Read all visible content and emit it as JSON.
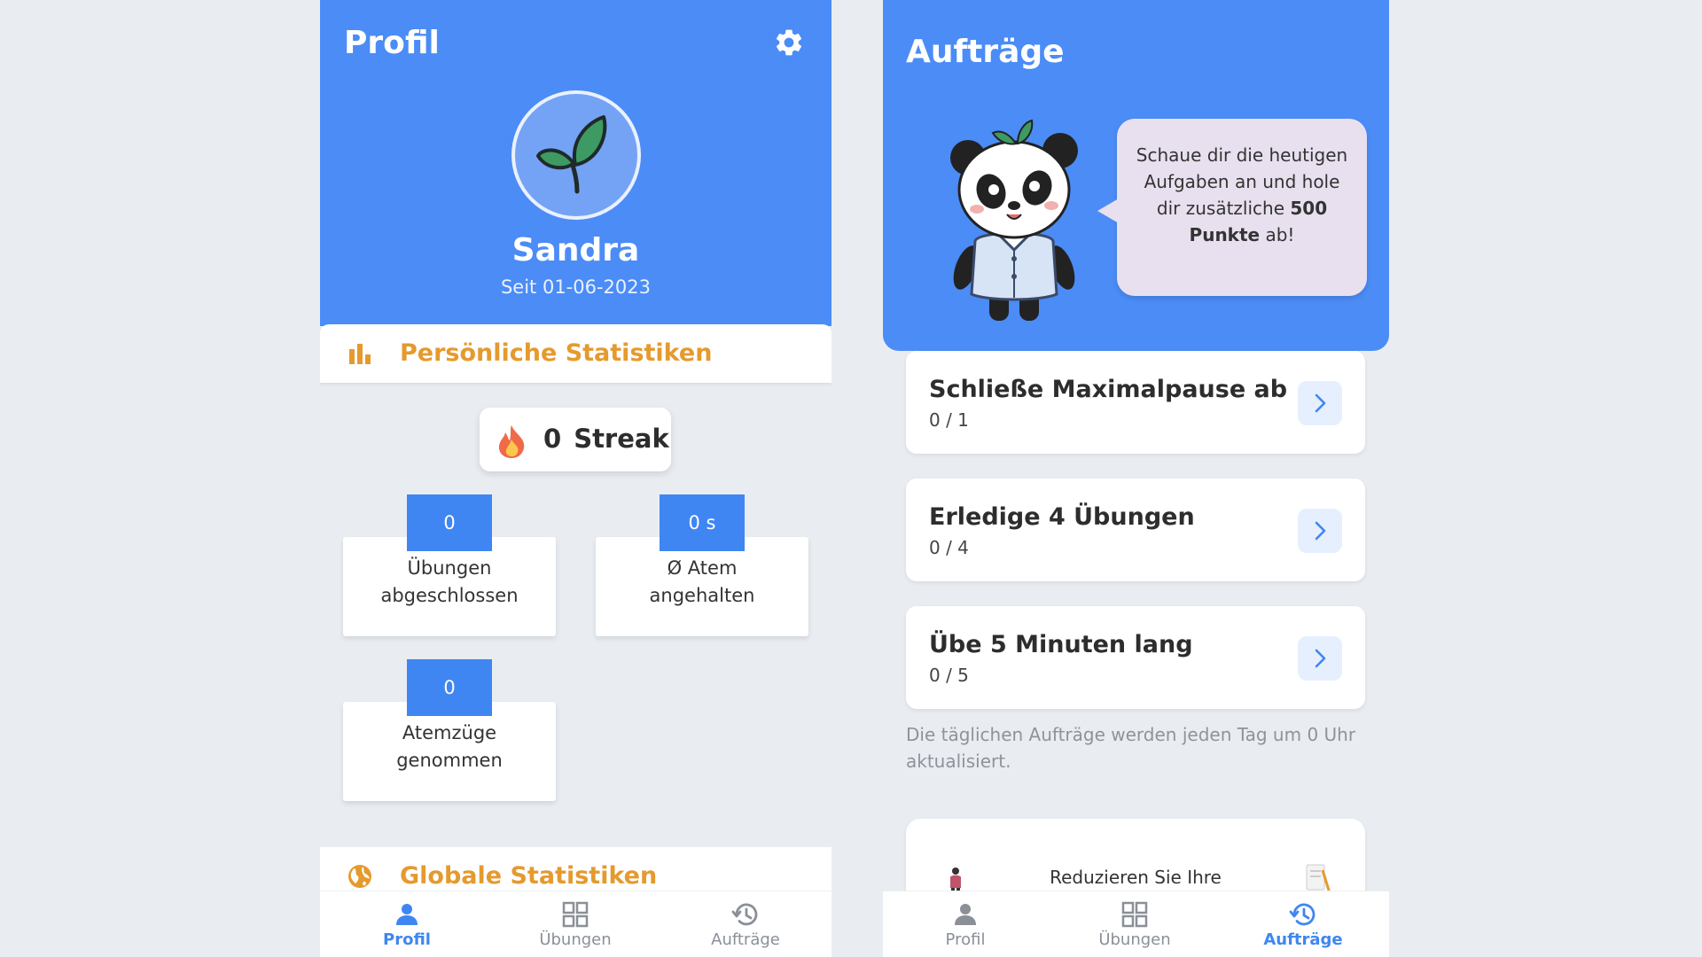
{
  "profile_screen": {
    "title": "Profil",
    "user": {
      "name": "Sandra",
      "since": "Seit 01-06-2023"
    },
    "personal_stats_heading": "Persönliche Statistiken",
    "streak": {
      "value": "0",
      "label": "Streak"
    },
    "stats": [
      {
        "value": "0",
        "line1": "Übungen",
        "line2": "abgeschlossen"
      },
      {
        "value": "0 s",
        "line1": "Ø Atem",
        "line2": "angehalten"
      },
      {
        "value": "0",
        "line1": "Atemzüge",
        "line2": "genommen"
      }
    ],
    "global_stats_heading": "Globale Statistiken",
    "nav": [
      {
        "label": "Profil",
        "icon": "person-icon",
        "active": true
      },
      {
        "label": "Übungen",
        "icon": "grid-icon",
        "active": false
      },
      {
        "label": "Aufträge",
        "icon": "history-icon",
        "active": false
      }
    ]
  },
  "quests_screen": {
    "title": "Aufträge",
    "bubble": {
      "text_before": "Schaue dir die heutigen Aufgaben an und hole dir zusätzliche ",
      "bold": "500 Punkte",
      "text_after": " ab!"
    },
    "quests": [
      {
        "title": "Schließe Maximalpause ab",
        "progress": "0 / 1"
      },
      {
        "title": "Erledige 4 Übungen",
        "progress": "0 / 4"
      },
      {
        "title": "Übe 5 Minuten lang",
        "progress": "0 / 5"
      }
    ],
    "note": "Die täglichen Aufträge werden jeden Tag um 0 Uhr aktualisiert.",
    "promo_text": "Reduzieren Sie Ihre",
    "nav": [
      {
        "label": "Profil",
        "icon": "person-icon",
        "active": false
      },
      {
        "label": "Übungen",
        "icon": "grid-icon",
        "active": false
      },
      {
        "label": "Aufträge",
        "icon": "history-icon",
        "active": true
      }
    ]
  },
  "colors": {
    "primary_blue": "#4b8cf6",
    "accent_orange": "#e59a2e",
    "background": "#e9edf2"
  }
}
